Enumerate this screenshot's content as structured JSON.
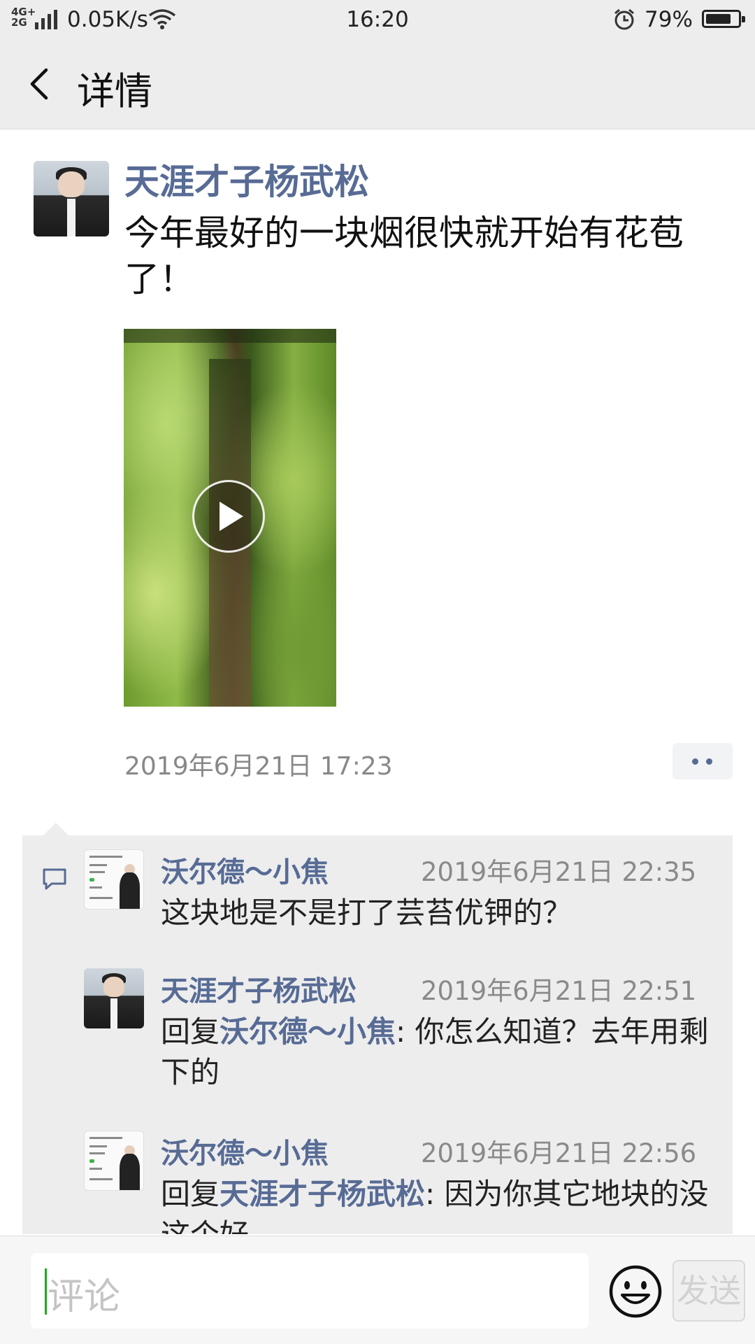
{
  "status_bar": {
    "network": "4G+ 2G",
    "speed": "0.05K/s",
    "time": "16:20",
    "battery": "79%",
    "battery_level": 0.79,
    "icons": [
      "signal-icon",
      "wifi-icon",
      "alarm-icon",
      "battery-icon"
    ]
  },
  "nav": {
    "back_icon": "chevron-left-icon",
    "title": "详情"
  },
  "post": {
    "author": "天涯才子杨武松",
    "text": "今年最好的一块烟很快就开始有花苞了！",
    "media": "video",
    "play_icon": "play-icon",
    "timestamp": "2019年6月21日 17:23",
    "more_icon": "more-dots-icon"
  },
  "comments": [
    {
      "name": "沃尔德～小焦",
      "time": "2019年6月21日 22:35",
      "text": "这块地是不是打了芸苔优钾的？"
    },
    {
      "name": "天涯才子杨武松",
      "time": "2019年6月21日 22:51",
      "reply_prefix": "回复",
      "reply_to": "沃尔德～小焦",
      "text": ": 你怎么知道？去年用剩下的"
    },
    {
      "name": "沃尔德～小焦",
      "time": "2019年6月21日 22:56",
      "reply_prefix": "回复",
      "reply_to": "天涯才子杨武松",
      "text": ": 因为你其它地块的没这个好"
    }
  ],
  "input_bar": {
    "placeholder": "评论",
    "emoji_icon": "emoji-smile-icon",
    "send_label": "发送"
  },
  "colors": {
    "link_blue": "#576b95",
    "bar_gray": "#ededed",
    "caret_green": "#1aad19"
  }
}
